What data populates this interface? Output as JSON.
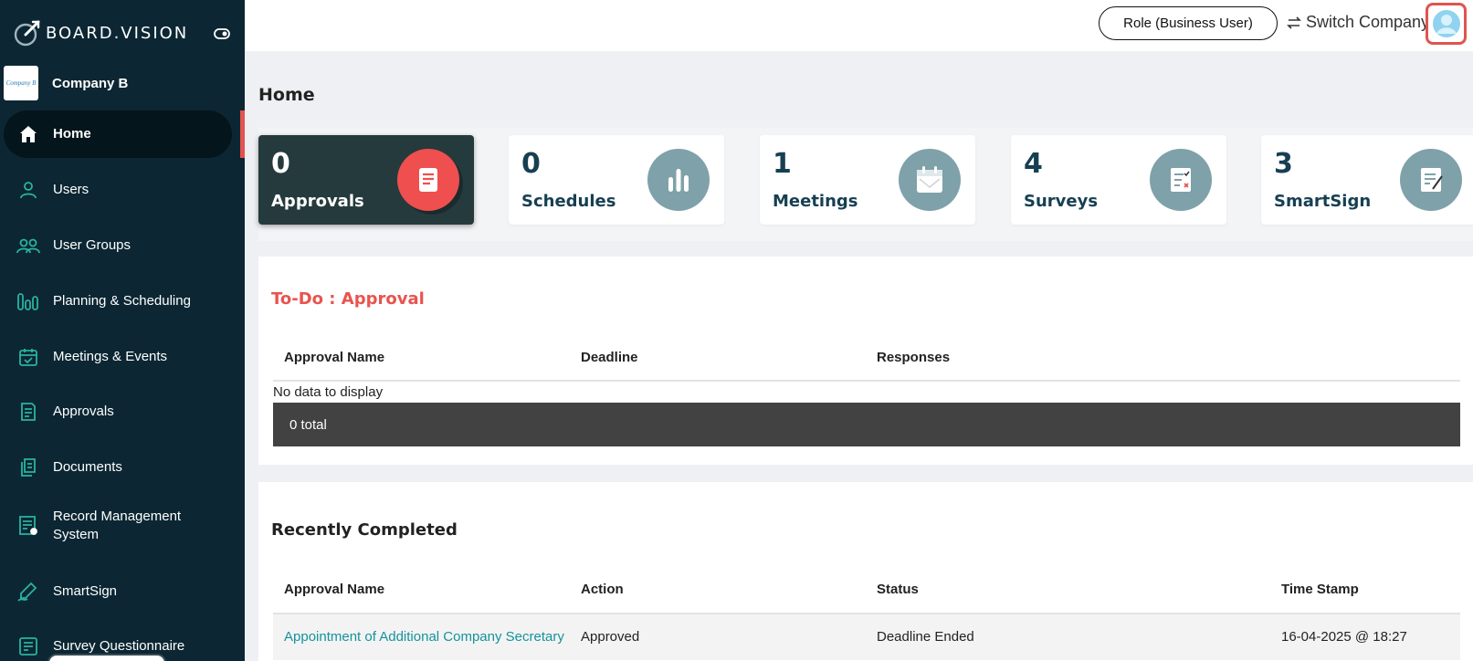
{
  "brand": {
    "name": "BOARD.VISION"
  },
  "company": {
    "logo_text": "Company B",
    "name": "Company B"
  },
  "sidebar": {
    "items": [
      {
        "label": "Home",
        "icon": "home-icon",
        "active": true
      },
      {
        "label": "Users",
        "icon": "user-icon"
      },
      {
        "label": "User Groups",
        "icon": "user-group-icon"
      },
      {
        "label": "Planning & Scheduling",
        "icon": "bar-chart-icon"
      },
      {
        "label": "Meetings & Events",
        "icon": "calendar-check-icon"
      },
      {
        "label": "Approvals",
        "icon": "document-icon"
      },
      {
        "label": "Documents",
        "icon": "documents-icon"
      },
      {
        "label": "Record Management System",
        "icon": "record-icon"
      },
      {
        "label": "SmartSign",
        "icon": "pen-icon"
      },
      {
        "label": "Survey Questionnaire",
        "icon": "checklist-icon"
      }
    ]
  },
  "header": {
    "role_label": "Role (Business User)",
    "switch_company_label": "Switch Company"
  },
  "page": {
    "title": "Home"
  },
  "stats": [
    {
      "count": "0",
      "label": "Approvals",
      "icon": "approval-doc-icon",
      "selected": true
    },
    {
      "count": "0",
      "label": "Schedules",
      "icon": "bar-chart-icon"
    },
    {
      "count": "1",
      "label": "Meetings",
      "icon": "calendar-icon"
    },
    {
      "count": "4",
      "label": "Surveys",
      "icon": "survey-icon"
    },
    {
      "count": "3",
      "label": "SmartSign",
      "icon": "sign-icon"
    }
  ],
  "todo": {
    "title": "To-Do : Approval",
    "columns": [
      "Approval Name",
      "Deadline",
      "Responses"
    ],
    "empty_text": "No data to display",
    "total_text": "0 total"
  },
  "recent": {
    "title": "Recently Completed",
    "columns": [
      "Approval Name",
      "Action",
      "Status",
      "Time Stamp"
    ],
    "rows": [
      {
        "name": "Appointment of Additional Company Secretary",
        "action": "Approved",
        "status": "Deadline Ended",
        "timestamp": "16-04-2025 @ 18:27"
      }
    ]
  },
  "colors": {
    "sidebar": "#0c2733",
    "accent_red": "#e8544f",
    "heading": "#173f52",
    "link": "#14939c"
  }
}
